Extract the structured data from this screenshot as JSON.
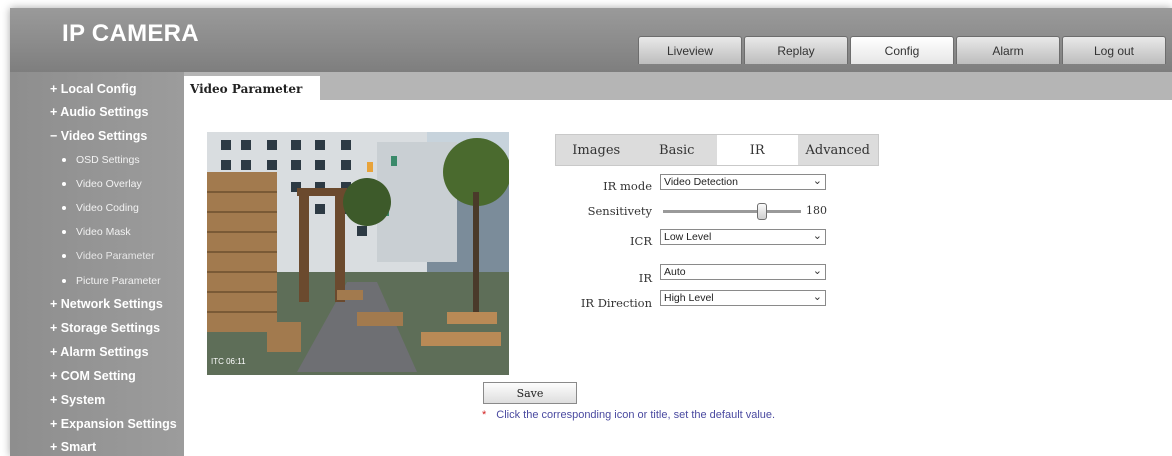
{
  "header": {
    "title": "IP CAMERA"
  },
  "nav": {
    "tabs": [
      {
        "label": "Liveview",
        "active": false
      },
      {
        "label": "Replay",
        "active": false
      },
      {
        "label": "Config",
        "active": true
      },
      {
        "label": "Alarm",
        "active": false
      },
      {
        "label": "Log out",
        "active": false
      }
    ]
  },
  "sidebar": {
    "local_config": "+ Local Config",
    "audio_settings": "+ Audio Settings",
    "video_settings": "− Video Settings",
    "sub": [
      {
        "label": "OSD Settings"
      },
      {
        "label": "Video Overlay"
      },
      {
        "label": "Video Coding"
      },
      {
        "label": "Video Mask"
      },
      {
        "label": "Video Parameter",
        "active": true
      },
      {
        "label": "Picture Parameter"
      }
    ],
    "network_settings": "+ Network Settings",
    "storage_settings": "+ Storage Settings",
    "alarm_settings": "+ Alarm Settings",
    "com_setting": "+ COM Setting",
    "system": "+ System",
    "expansion_settings": "+ Expansion Settings",
    "smart": "+ Smart"
  },
  "content": {
    "tab_title": "Video Parameter",
    "preview_timestamp": "ITC 06:11",
    "sub_tabs": [
      {
        "label": "Images",
        "active": false
      },
      {
        "label": "Basic",
        "active": false
      },
      {
        "label": "IR",
        "active": true
      },
      {
        "label": "Advanced",
        "active": false
      }
    ],
    "form": {
      "ir_mode_label": "IR mode",
      "ir_mode_value": "Video Detection",
      "sensitivity_label": "Sensitivety",
      "sensitivity_value": "180",
      "sensitivity_level": 0.72,
      "icr_label": "ICR",
      "icr_value": "Low Level",
      "ir_label": "IR",
      "ir_value": "Auto",
      "ir_direction_label": "IR Direction",
      "ir_direction_value": "High Level"
    },
    "save_label": "Save",
    "hint_star": "*",
    "hint_text": "Click the corresponding icon or title, set the default value."
  },
  "colors": {
    "header_bg": "#8a8a8a",
    "sidebar_bg": "#959595",
    "hint_text": "#4a4aa0",
    "hint_star": "#d21f1f"
  }
}
